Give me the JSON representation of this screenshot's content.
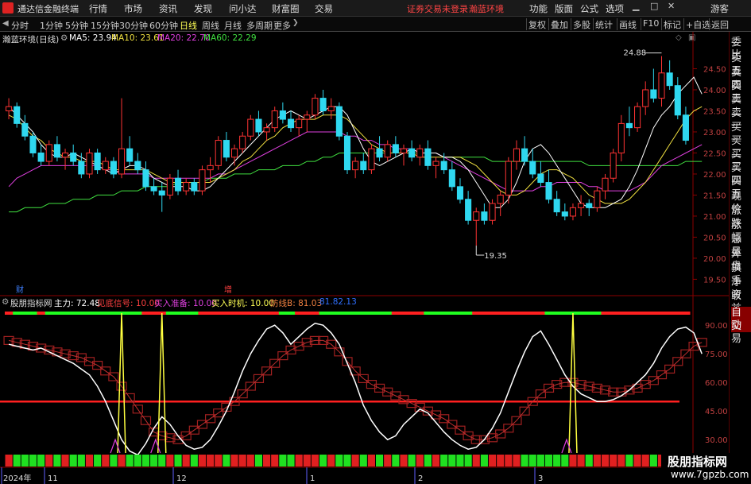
{
  "app": {
    "name": "通达信金融终端",
    "menus": [
      "行情",
      "市场",
      "资讯",
      "发现",
      "问小达",
      "财富圈",
      "交易"
    ],
    "notice": "证券交易未登录",
    "notice2": "瀚蓝环境",
    "right_menus": [
      "功能",
      "版面",
      "公式",
      "选项"
    ],
    "user": "游客"
  },
  "toolbar": {
    "periods": [
      "分时",
      "1分钟",
      "5分钟",
      "15分钟",
      "30分钟",
      "60分钟",
      "日线",
      "周线",
      "月线",
      "多周期",
      "更多"
    ],
    "active_period": "日线",
    "buttons": [
      "复权",
      "叠加",
      "多股",
      "统计",
      "画线",
      "F10",
      "标记",
      "+自选",
      "返回"
    ]
  },
  "right_panel": {
    "items": [
      "委比",
      "卖五",
      "卖四",
      "卖三",
      "卖二",
      "卖一",
      "买一",
      "买二",
      "买三",
      "买四",
      "买五",
      "现价",
      "涨跌",
      "涨幅",
      "总量",
      "外盘",
      "换手",
      "净资",
      "收益",
      "自动",
      "交易"
    ],
    "selected": "自动"
  },
  "main_header": {
    "stock": "瀚蓝环境(日线)",
    "ma5_label": "MA5: 23.94",
    "ma10_label": "MA10: 23.61",
    "ma20_label": "MA20: 22.70",
    "ma60_label": "MA60: 22.29"
  },
  "indicator_header": {
    "name": "股朋指标网",
    "main_force": "主力: 72.48",
    "bottom_signal": "见底信号: 10.00",
    "buy_prepare": "买入准备: 10.00",
    "buy_time": "买入时机: 10.00",
    "defense": "防线B: 81.03",
    "extra": "81.82.13"
  },
  "markers": {
    "cai": "财",
    "zeng": "增"
  },
  "colors": {
    "up": "#ff3333",
    "down": "#2fd8f0",
    "ma5": "#ffffff",
    "ma10": "#f0e040",
    "ma20": "#e040e0",
    "ma60": "#40e040",
    "grid": "#8b0000",
    "axis_text": "#c04040"
  },
  "chart_data": [
    {
      "type": "candlestick",
      "title": "瀚蓝环境(日线)",
      "y_ticks": [
        "24.50",
        "24.00",
        "23.50",
        "23.00",
        "22.50",
        "22.00",
        "21.50",
        "21.00",
        "20.50",
        "20.00",
        "19.50"
      ],
      "ylim": [
        19.3,
        25.0
      ],
      "annotations": {
        "high": "24.88",
        "low": "19.35"
      },
      "x_labels": [
        "2024年",
        "11",
        "12",
        "1",
        "2",
        "3"
      ],
      "series": [
        {
          "name": "MA5",
          "values": [
            23.6,
            23.4,
            23.2,
            23.0,
            22.7,
            22.5,
            22.4,
            22.4,
            22.5,
            22.4,
            22.3,
            22.2,
            22.1,
            22.0,
            22.1,
            22.2,
            22.2,
            22.1,
            21.9,
            21.8,
            21.7,
            21.7,
            21.7,
            21.6,
            21.6,
            21.7,
            21.9,
            22.1,
            22.3,
            22.5,
            22.7,
            22.9,
            23.1,
            23.3,
            23.4,
            23.5,
            23.4,
            23.3,
            23.4,
            23.5,
            23.6,
            23.6,
            23.4,
            23.0,
            22.6,
            22.3,
            22.2,
            22.3,
            22.4,
            22.5,
            22.6,
            22.5,
            22.5,
            22.5,
            22.4,
            22.4,
            22.3,
            22.1,
            21.8,
            21.5,
            21.2,
            21.2,
            21.4,
            21.8,
            22.3,
            22.6,
            22.7,
            22.5,
            22.2,
            21.9,
            21.6,
            21.3,
            21.2,
            21.2,
            21.2,
            21.3,
            21.4,
            21.7,
            22.1,
            22.6,
            23.1,
            23.4,
            23.6,
            23.9,
            24.1,
            24.3,
            23.9
          ]
        },
        {
          "name": "MA10",
          "values": [
            23.4,
            23.3,
            23.1,
            22.9,
            22.8,
            22.6,
            22.5,
            22.4,
            22.4,
            22.3,
            22.3,
            22.3,
            22.2,
            22.1,
            22.1,
            22.1,
            22.1,
            22.1,
            22.0,
            21.9,
            21.8,
            21.8,
            21.8,
            21.8,
            21.8,
            21.8,
            21.9,
            22.0,
            22.1,
            22.3,
            22.4,
            22.6,
            22.8,
            22.9,
            23.1,
            23.2,
            23.3,
            23.3,
            23.3,
            23.4,
            23.4,
            23.4,
            23.3,
            23.1,
            22.9,
            22.7,
            22.6,
            22.5,
            22.5,
            22.5,
            22.5,
            22.4,
            22.4,
            22.4,
            22.4,
            22.4,
            22.4,
            22.3,
            22.2,
            22.0,
            21.8,
            21.6,
            21.5,
            21.5,
            21.6,
            21.8,
            22.0,
            22.1,
            22.1,
            22.0,
            21.9,
            21.7,
            21.5,
            21.4,
            21.3,
            21.3,
            21.3,
            21.4,
            21.6,
            21.8,
            22.1,
            22.4,
            22.7,
            23.0,
            23.3,
            23.5,
            23.6
          ]
        },
        {
          "name": "MA20",
          "values": [
            21.7,
            21.9,
            22.0,
            22.1,
            22.2,
            22.2,
            22.2,
            22.2,
            22.2,
            22.2,
            22.2,
            22.2,
            22.1,
            22.1,
            22.0,
            22.0,
            22.0,
            22.0,
            21.9,
            21.9,
            21.9,
            21.9,
            21.9,
            21.9,
            21.9,
            21.9,
            22.0,
            22.0,
            22.1,
            22.2,
            22.3,
            22.4,
            22.5,
            22.6,
            22.7,
            22.8,
            22.9,
            23.0,
            23.0,
            23.0,
            23.0,
            23.0,
            22.9,
            22.9,
            22.8,
            22.8,
            22.7,
            22.7,
            22.6,
            22.6,
            22.6,
            22.5,
            22.5,
            22.5,
            22.4,
            22.3,
            22.2,
            22.1,
            22.0,
            21.9,
            21.8,
            21.7,
            21.6,
            21.6,
            21.6,
            21.6,
            21.7,
            21.7,
            21.8,
            21.8,
            21.8,
            21.8,
            21.7,
            21.7,
            21.6,
            21.6,
            21.6,
            21.6,
            21.7,
            21.8,
            22.0,
            22.2,
            22.3,
            22.4,
            22.5,
            22.6,
            22.7
          ]
        },
        {
          "name": "MA60",
          "values": [
            21.1,
            21.1,
            21.2,
            21.2,
            21.2,
            21.3,
            21.3,
            21.3,
            21.4,
            21.4,
            21.4,
            21.5,
            21.5,
            21.5,
            21.6,
            21.6,
            21.6,
            21.7,
            21.7,
            21.7,
            21.7,
            21.8,
            21.8,
            21.8,
            21.8,
            21.9,
            21.9,
            21.9,
            22.0,
            22.0,
            22.0,
            22.1,
            22.1,
            22.1,
            22.2,
            22.2,
            22.2,
            22.3,
            22.3,
            22.4,
            22.4,
            22.5,
            22.5,
            22.5,
            22.5,
            22.5,
            22.5,
            22.5,
            22.5,
            22.5,
            22.5,
            22.5,
            22.5,
            22.5,
            22.4,
            22.4,
            22.4,
            22.4,
            22.4,
            22.4,
            22.3,
            22.3,
            22.3,
            22.3,
            22.3,
            22.3,
            22.3,
            22.3,
            22.3,
            22.3,
            22.3,
            22.3,
            22.2,
            22.2,
            22.2,
            22.2,
            22.2,
            22.2,
            22.2,
            22.2,
            22.2,
            22.2,
            22.2,
            22.2,
            22.3,
            22.3,
            22.3
          ]
        }
      ],
      "ohlc": [
        [
          23.5,
          23.8,
          23.3,
          23.6
        ],
        [
          23.6,
          23.7,
          23.1,
          23.2
        ],
        [
          23.2,
          23.4,
          22.8,
          22.9
        ],
        [
          22.9,
          23.0,
          22.4,
          22.5
        ],
        [
          22.5,
          22.7,
          22.2,
          22.3
        ],
        [
          22.3,
          22.8,
          22.2,
          22.7
        ],
        [
          22.7,
          22.9,
          22.3,
          22.4
        ],
        [
          22.4,
          22.6,
          22.1,
          22.5
        ],
        [
          22.5,
          22.7,
          22.2,
          22.3
        ],
        [
          22.3,
          22.5,
          21.9,
          22.0
        ],
        [
          22.0,
          22.6,
          21.9,
          22.5
        ],
        [
          22.5,
          22.6,
          22.0,
          22.1
        ],
        [
          22.1,
          22.4,
          22.0,
          22.3
        ],
        [
          22.3,
          22.4,
          21.9,
          22.0
        ],
        [
          22.0,
          23.8,
          21.9,
          22.6
        ],
        [
          22.6,
          22.9,
          22.2,
          22.3
        ],
        [
          22.3,
          22.5,
          22.0,
          22.1
        ],
        [
          22.1,
          22.3,
          21.6,
          21.7
        ],
        [
          21.7,
          21.9,
          21.5,
          21.6
        ],
        [
          21.6,
          21.8,
          21.1,
          21.5
        ],
        [
          21.5,
          22.0,
          21.4,
          21.9
        ],
        [
          21.9,
          22.1,
          21.5,
          21.6
        ],
        [
          21.6,
          21.9,
          21.5,
          21.8
        ],
        [
          21.8,
          21.9,
          21.5,
          21.6
        ],
        [
          21.6,
          22.2,
          21.5,
          22.1
        ],
        [
          22.1,
          22.4,
          21.8,
          22.2
        ],
        [
          22.2,
          22.9,
          22.1,
          22.8
        ],
        [
          22.8,
          23.0,
          22.3,
          22.4
        ],
        [
          22.4,
          22.7,
          22.2,
          22.6
        ],
        [
          22.6,
          23.0,
          22.5,
          22.9
        ],
        [
          22.9,
          23.4,
          22.8,
          23.3
        ],
        [
          23.3,
          23.5,
          22.9,
          23.0
        ],
        [
          23.0,
          23.2,
          22.8,
          23.1
        ],
        [
          23.1,
          23.6,
          23.0,
          23.5
        ],
        [
          23.5,
          23.7,
          23.2,
          23.3
        ],
        [
          23.3,
          23.5,
          23.0,
          23.1
        ],
        [
          23.1,
          23.4,
          22.9,
          23.3
        ],
        [
          23.3,
          23.5,
          23.0,
          23.4
        ],
        [
          23.4,
          23.9,
          23.3,
          23.8
        ],
        [
          23.8,
          24.0,
          23.4,
          23.5
        ],
        [
          23.5,
          23.8,
          23.3,
          23.6
        ],
        [
          23.6,
          23.7,
          22.8,
          22.9
        ],
        [
          22.9,
          23.0,
          22.0,
          22.1
        ],
        [
          22.1,
          22.4,
          21.9,
          22.3
        ],
        [
          22.3,
          22.5,
          22.0,
          22.1
        ],
        [
          22.1,
          22.7,
          22.0,
          22.6
        ],
        [
          22.6,
          22.9,
          22.3,
          22.4
        ],
        [
          22.4,
          22.8,
          22.3,
          22.7
        ],
        [
          22.7,
          22.9,
          22.4,
          22.5
        ],
        [
          22.5,
          22.7,
          22.2,
          22.6
        ],
        [
          22.6,
          22.8,
          22.3,
          22.4
        ],
        [
          22.4,
          22.7,
          22.2,
          22.6
        ],
        [
          22.6,
          22.8,
          22.1,
          22.2
        ],
        [
          22.2,
          22.4,
          21.9,
          22.3
        ],
        [
          22.3,
          22.5,
          22.0,
          22.1
        ],
        [
          22.1,
          22.3,
          21.6,
          21.7
        ],
        [
          21.7,
          21.9,
          21.3,
          21.4
        ],
        [
          21.4,
          21.6,
          20.8,
          20.9
        ],
        [
          20.9,
          21.2,
          20.3,
          21.1
        ],
        [
          21.1,
          21.3,
          20.8,
          20.9
        ],
        [
          20.9,
          21.4,
          20.8,
          21.3
        ],
        [
          21.3,
          21.6,
          21.0,
          21.5
        ],
        [
          21.5,
          22.4,
          21.3,
          22.3
        ],
        [
          22.3,
          22.8,
          22.1,
          22.6
        ],
        [
          22.6,
          22.9,
          22.2,
          22.3
        ],
        [
          22.3,
          22.6,
          21.9,
          22.0
        ],
        [
          22.0,
          22.3,
          21.7,
          21.8
        ],
        [
          21.8,
          22.1,
          21.3,
          21.4
        ],
        [
          21.4,
          21.6,
          21.0,
          21.1
        ],
        [
          21.1,
          21.3,
          20.9,
          21.0
        ],
        [
          21.0,
          21.3,
          20.9,
          21.2
        ],
        [
          21.2,
          21.5,
          21.0,
          21.3
        ],
        [
          21.3,
          21.4,
          21.0,
          21.2
        ],
        [
          21.2,
          21.7,
          21.1,
          21.6
        ],
        [
          21.6,
          22.0,
          21.4,
          21.9
        ],
        [
          21.9,
          22.6,
          21.8,
          22.5
        ],
        [
          22.5,
          23.4,
          22.3,
          23.2
        ],
        [
          23.2,
          23.6,
          22.9,
          23.1
        ],
        [
          23.1,
          23.7,
          23.0,
          23.6
        ],
        [
          23.6,
          24.2,
          23.4,
          24.0
        ],
        [
          24.0,
          24.5,
          23.7,
          23.8
        ],
        [
          23.8,
          24.8,
          23.6,
          24.4
        ],
        [
          24.4,
          24.7,
          24.0,
          24.1
        ],
        [
          24.1,
          24.3,
          23.3,
          23.4
        ],
        [
          23.4,
          23.6,
          22.7,
          22.8
        ]
      ]
    },
    {
      "type": "line",
      "title": "股朋指标网",
      "y_ticks": [
        "90.00",
        "75.00",
        "60.00",
        "45.00",
        "30.00"
      ],
      "right_labels": [
        "14:56",
        "14:56",
        "14:56",
        "14:56",
        "14:56",
        "14:56",
        "14:56",
        "14:56",
        "14:56",
        "14:56",
        "14:56"
      ],
      "ylim": [
        23,
        98
      ],
      "hline": 50,
      "series": [
        {
          "name": "主力",
          "values": [
            80,
            79,
            78,
            77,
            78,
            76,
            74,
            72,
            70,
            67,
            64,
            58,
            50,
            40,
            30,
            24,
            22,
            28,
            36,
            42,
            38,
            32,
            27,
            25,
            26,
            30,
            37,
            45,
            55,
            66,
            75,
            82,
            88,
            90,
            86,
            80,
            84,
            88,
            91,
            90,
            86,
            80,
            70,
            60,
            48,
            40,
            34,
            30,
            32,
            38,
            42,
            46,
            44,
            39,
            34,
            30,
            27,
            25,
            26,
            30,
            36,
            44,
            55,
            66,
            76,
            84,
            87,
            80,
            72,
            64,
            58,
            54,
            52,
            50,
            50,
            51,
            53,
            56,
            60,
            64,
            70,
            78,
            84,
            88,
            89,
            86,
            75
          ]
        },
        {
          "name": "防线B",
          "values": [
            82,
            81,
            80,
            79,
            78,
            77,
            76,
            75,
            74,
            73,
            71,
            69,
            66,
            63,
            58,
            52,
            46,
            40,
            34,
            32,
            31,
            30,
            32,
            35,
            38,
            41,
            44,
            47,
            50,
            54,
            58,
            62,
            66,
            70,
            74,
            77,
            79,
            81,
            82,
            82,
            80,
            76,
            71,
            66,
            62,
            59,
            57,
            55,
            53,
            51,
            49,
            47,
            45,
            43,
            41,
            38,
            35,
            32,
            30,
            30,
            31,
            33,
            36,
            40,
            45,
            50,
            54,
            57,
            59,
            60,
            60,
            59,
            58,
            57,
            56,
            55,
            55,
            56,
            57,
            59,
            61,
            64,
            67,
            71,
            75,
            79,
            81
          ]
        },
        {
          "name": "见底信号",
          "spikes": [
            14,
            19,
            70
          ]
        }
      ]
    }
  ]
}
